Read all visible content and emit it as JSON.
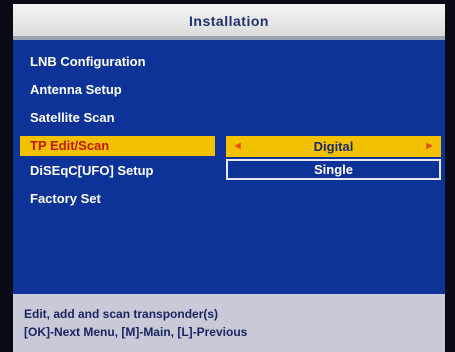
{
  "header": {
    "title": "Installation"
  },
  "menu": {
    "items": [
      {
        "label": "LNB Configuration"
      },
      {
        "label": "Antenna Setup"
      },
      {
        "label": "Satellite Scan"
      },
      {
        "label": "TP Edit/Scan",
        "selected": true
      },
      {
        "label": "DiSEqC[UFO] Setup"
      },
      {
        "label": "Factory Set"
      }
    ]
  },
  "values": {
    "tp_edit_scan": "Digital",
    "diseqc_setup": "Single"
  },
  "icons": {
    "left_arrow": "◄",
    "right_arrow": "►"
  },
  "footer": {
    "help_line_1": "Edit, add and scan transponder(s)",
    "help_line_2": "[OK]-Next Menu, [M]-Main, [L]-Previous"
  },
  "colors": {
    "menu_background": "#0d3398",
    "highlight": "#f2c100",
    "selected_text": "#c01818",
    "arrow": "#e84a10",
    "footer_background": "#c8cad8"
  }
}
